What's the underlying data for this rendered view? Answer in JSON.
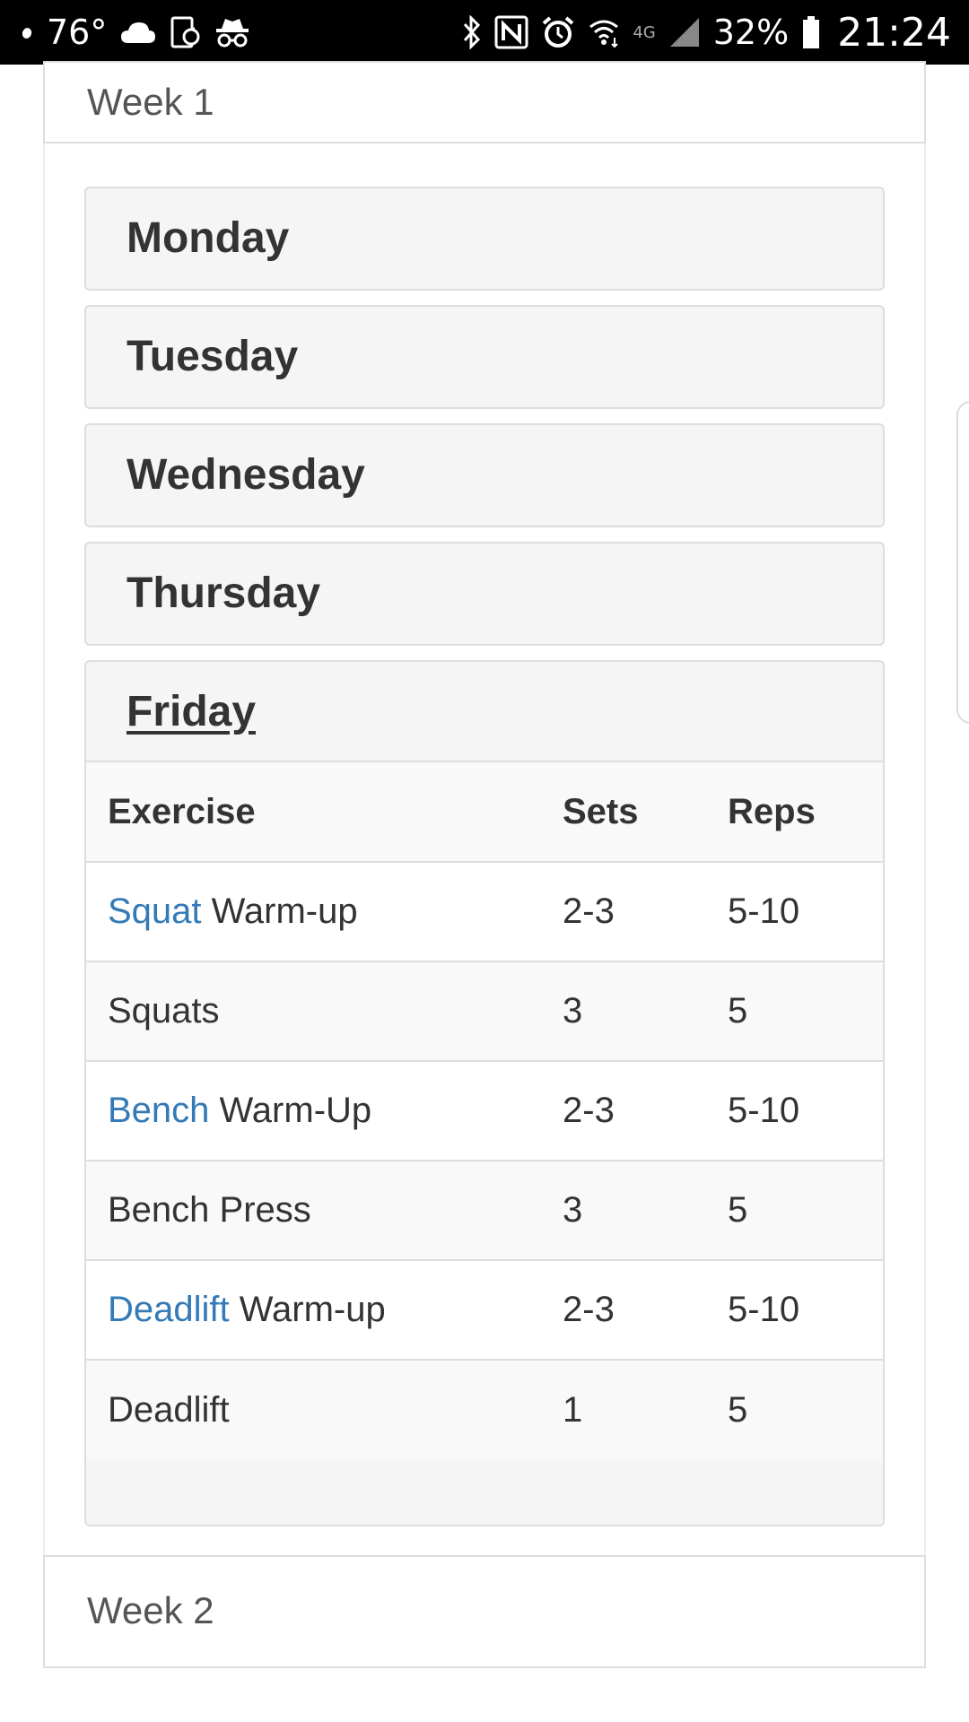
{
  "status_bar": {
    "temperature": "76°",
    "network_type": "4G",
    "battery": "32%",
    "time": "21:24"
  },
  "week1": {
    "title": "Week 1",
    "days": [
      {
        "label": "Monday"
      },
      {
        "label": "Tuesday"
      },
      {
        "label": "Wednesday"
      },
      {
        "label": "Thursday"
      },
      {
        "label": "Friday"
      }
    ]
  },
  "table": {
    "headers": {
      "exercise": "Exercise",
      "sets": "Sets",
      "reps": "Reps"
    },
    "rows": [
      {
        "link": "Squat",
        "text": " Warm-up",
        "sets": "2-3",
        "reps": "5-10"
      },
      {
        "link": "",
        "text": "Squats",
        "sets": "3",
        "reps": "5"
      },
      {
        "link": "Bench",
        "text": " Warm-Up",
        "sets": "2-3",
        "reps": "5-10"
      },
      {
        "link": "",
        "text": "Bench Press",
        "sets": "3",
        "reps": "5"
      },
      {
        "link": "Deadlift",
        "text": " Warm-up",
        "sets": "2-3",
        "reps": "5-10"
      },
      {
        "link": "",
        "text": "Deadlift",
        "sets": "1",
        "reps": "5"
      }
    ]
  },
  "week2": {
    "title": "Week 2"
  },
  "colors": {
    "link": "#337ab7",
    "panel_bg": "#f5f5f5",
    "border": "#dddddd"
  }
}
